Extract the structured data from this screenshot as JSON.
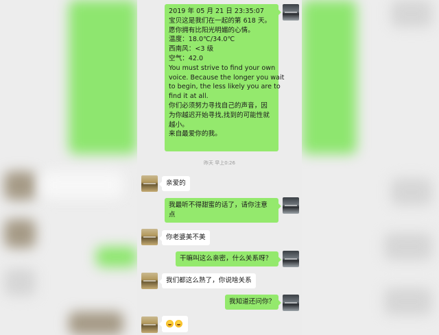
{
  "chat": {
    "messages": [
      {
        "sender": "me",
        "lines": [
          "2019 年 05 月 21 日 23:35:07",
          "宝贝这是我们在一起的第 618 天。",
          "愿你拥有比阳光明媚的心情。",
          "温度：18.0℃/34.0℃",
          "西南风：<3 级",
          "空气：42.0",
          "You must strive to find your own",
          "voice. Because the longer you wait",
          "to begin, the less likely you are to",
          "find it at all.",
          " 你们必须努力寻找自己的声音，因",
          "为你越迟开始寻找,找到的可能性就",
          "越小。",
          "来自最爱你的我。"
        ]
      },
      {
        "sender": "her",
        "lines": [
          "亲爱的"
        ]
      },
      {
        "sender": "me",
        "lines": [
          "我最听不得甜蜜的话了，请你注意",
          "点"
        ]
      },
      {
        "sender": "her",
        "lines": [
          "你老婆美不美"
        ]
      },
      {
        "sender": "me",
        "lines": [
          "干嘛叫这么亲密，什么关系呀？"
        ]
      },
      {
        "sender": "her",
        "lines": [
          "我们都这么熟了，你说啥关系"
        ]
      },
      {
        "sender": "me",
        "lines": [
          "我知道还问你？"
        ]
      },
      {
        "sender": "her",
        "emoji": [
          "grin-sweat-emoji",
          "grin-sweat-emoji"
        ]
      }
    ],
    "timestamp": "昨天 早上0:26"
  },
  "colors": {
    "my_bubble": "#94e96d",
    "her_bubble": "#ffffff",
    "background": "#ececec"
  }
}
